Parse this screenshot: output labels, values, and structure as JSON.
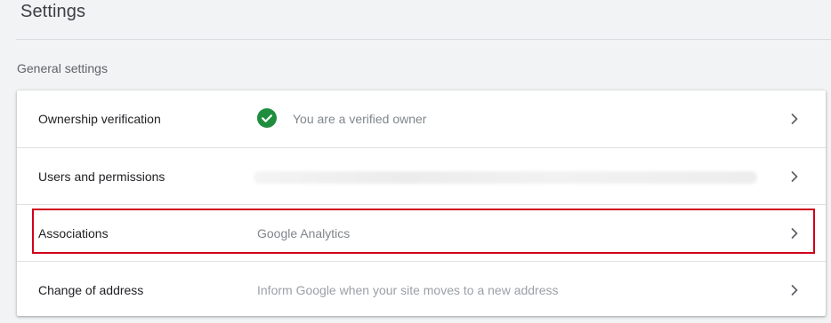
{
  "page": {
    "title": "Settings"
  },
  "section": {
    "label": "General settings"
  },
  "rows": [
    {
      "label": "Ownership verification",
      "value": "You are a verified owner",
      "status": "verified"
    },
    {
      "label": "Users and permissions",
      "value": ""
    },
    {
      "label": "Associations",
      "value": "Google Analytics"
    },
    {
      "label": "Change of address",
      "value": "Inform Google when your site moves to a new address"
    }
  ],
  "colors": {
    "verified_green": "#1e8e3e",
    "highlight_red": "#d0021b"
  },
  "icons": {
    "status": "check-circle-icon",
    "row_action": "chevron-right-icon"
  }
}
